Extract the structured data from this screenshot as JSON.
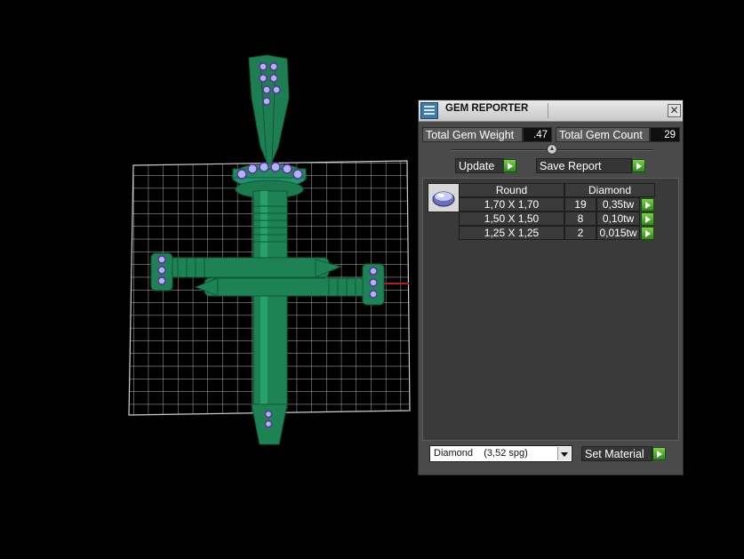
{
  "panel": {
    "title": "GEM REPORTER",
    "close_glyph": "✕",
    "total_gem_weight_label": "Total Gem Weight",
    "total_gem_weight_value": ".47",
    "total_gem_count_label": "Total Gem Count",
    "total_gem_count_value": "29",
    "update_label": "Update",
    "save_report_label": "Save Report",
    "table": {
      "headers": [
        "Round",
        "Diamond"
      ],
      "rows": [
        {
          "size": "1,70 X 1,70",
          "count": "19",
          "weight": "0,35tw"
        },
        {
          "size": "1,50 X 1,50",
          "count": "8",
          "weight": "0,10tw"
        },
        {
          "size": "1,25 X 1,25",
          "count": "2",
          "weight": "0,015tw"
        }
      ]
    },
    "material_selected": "Diamond    (3,52 spg)",
    "set_material_label": "Set Material"
  },
  "icons": {
    "title": "gem-reporter-icon",
    "close": "close-icon",
    "go": "play-arrow-icon",
    "gem": "round-gem-icon",
    "dropdown": "chevron-down-icon"
  },
  "colors": {
    "model_green": "#1f8a5a",
    "gem_lilac": "#9fb0f0",
    "go_green": "#3fa02a",
    "panel_gray": "#4a4a4a"
  }
}
